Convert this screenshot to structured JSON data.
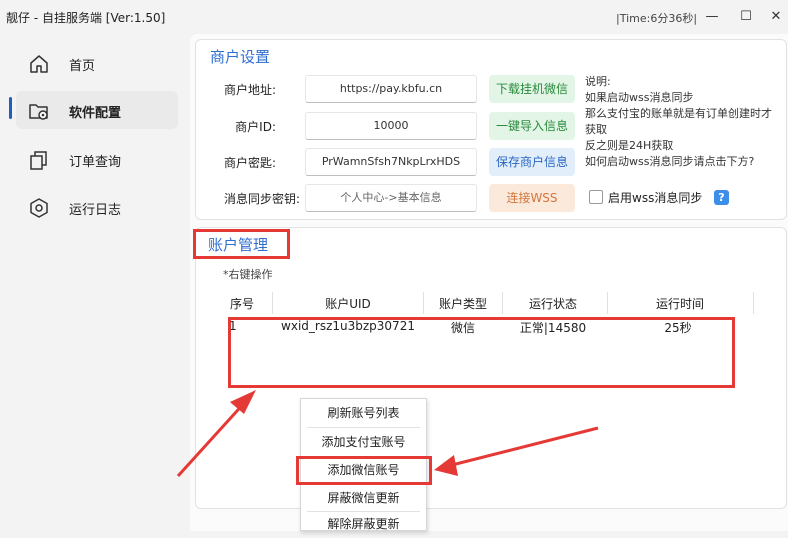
{
  "window": {
    "title": "靓仔 - 自挂服务端  [Ver:1.50]",
    "time_badge": "|Time:6分36秒|"
  },
  "sidebar": {
    "items": [
      {
        "label": "首页",
        "icon": "home-icon"
      },
      {
        "label": "软件配置",
        "icon": "settings-folder-icon",
        "active": true
      },
      {
        "label": "订单查询",
        "icon": "copy-icon"
      },
      {
        "label": "运行日志",
        "icon": "hexagon-icon"
      }
    ]
  },
  "merchant": {
    "title": "商户设置",
    "fields": [
      {
        "label": "商户地址:",
        "value": "https://pay.kbfu.cn"
      },
      {
        "label": "商户ID:",
        "value": "10000"
      },
      {
        "label": "商户密匙:",
        "value": "PrWamnSfsh7NkpLrxHDS"
      },
      {
        "label": "消息同步密钥:",
        "placeholder": "个人中心->基本信息"
      }
    ],
    "buttons": {
      "download": "下载挂机微信",
      "import": "一键导入信息",
      "save": "保存商户信息",
      "connect": "连接WSS"
    },
    "notes": [
      "说明:",
      "如果启动wss消息同步",
      "那么支付宝的账单就是有订单创建时才",
      "获取",
      "反之则是24H获取",
      "如何启动wss消息同步请点击下方?"
    ],
    "wss_checkbox_label": "启用wss消息同步",
    "wss_checked": false,
    "help_icon": "?"
  },
  "account": {
    "title": "账户管理",
    "hint": "*右键操作",
    "columns": [
      "序号",
      "账户UID",
      "账户类型",
      "运行状态",
      "运行时间"
    ],
    "rows": [
      {
        "index": "1",
        "uid": "wxid_rsz1u3bzp30721",
        "type": "微信",
        "status": "正常|14580",
        "time": "25秒"
      }
    ]
  },
  "context_menu": {
    "items": [
      "刷新账号列表",
      "添加支付宝账号",
      "添加微信账号",
      "屏蔽微信更新",
      "解除屏蔽更新"
    ]
  },
  "colors": {
    "accent": "#2f6fd0",
    "highlight_red": "#e53935",
    "green_btn": "#2a8a3c",
    "blue_btn": "#2a66c0",
    "orange_btn": "#d3763a"
  }
}
